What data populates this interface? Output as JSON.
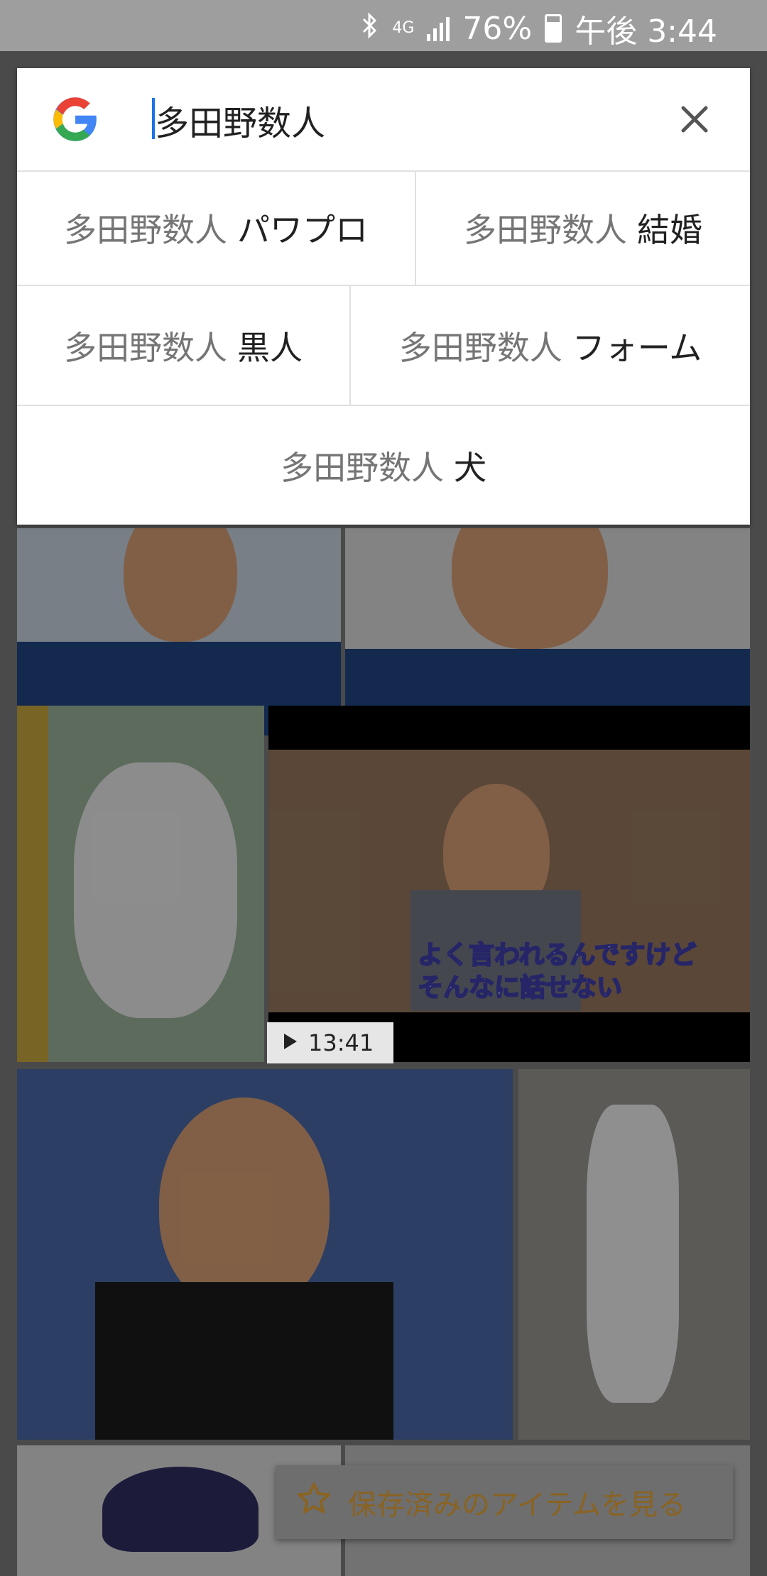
{
  "status_bar": {
    "network": "4G",
    "battery": "76%",
    "time": "午後 3:44",
    "icons": [
      "bluetooth-icon",
      "signal-icon",
      "battery-charging-icon"
    ]
  },
  "search": {
    "query": "多田野数人",
    "clear_icon": "close-icon"
  },
  "suggestions": [
    {
      "prefix": "多田野数人",
      "suffix": "パワプロ"
    },
    {
      "prefix": "多田野数人",
      "suffix": "結婚"
    },
    {
      "prefix": "多田野数人",
      "suffix": "黒人"
    },
    {
      "prefix": "多田野数人",
      "suffix": "フォーム"
    },
    {
      "prefix": "多田野数人",
      "suffix": "犬"
    }
  ],
  "video": {
    "duration": "13:41",
    "caption_line1": "よく言われるんですけど",
    "caption_line2": "そんなに話せない"
  },
  "saved_button": {
    "label": "保存済みのアイテムを見る",
    "icon": "star-icon"
  },
  "colors": {
    "accent": "#1a73e8",
    "saved_text": "#8a6322"
  }
}
